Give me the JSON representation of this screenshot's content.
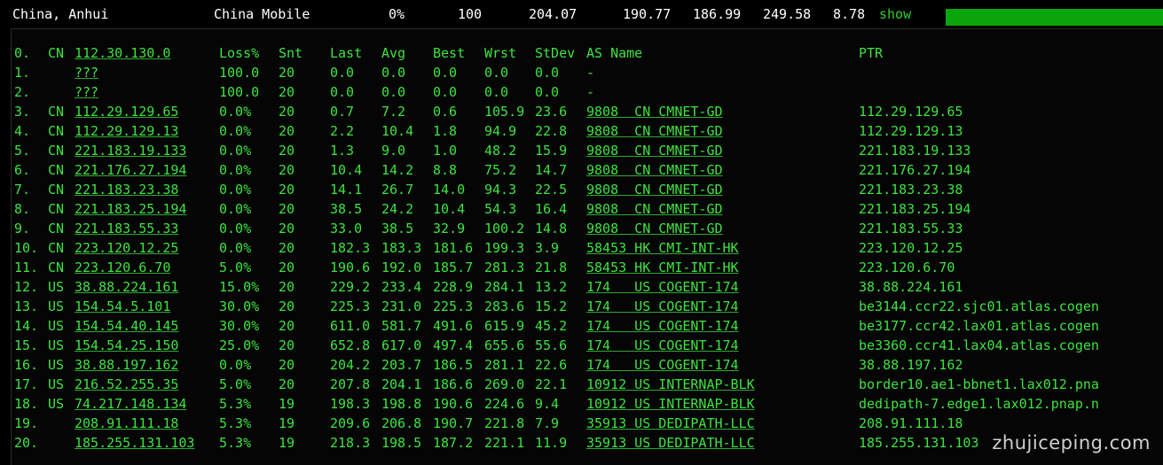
{
  "summary": {
    "location": "China, Anhui",
    "isp": "China Mobile",
    "loss": "0%",
    "sent": "100",
    "last": "204.07",
    "avg": "190.77",
    "best": "186.99",
    "worst": "249.58",
    "stdev": "8.78",
    "show_label": "show",
    "progress": 1.0
  },
  "header": {
    "hop": "0.",
    "cc": "CN",
    "host": "112.30.130.0",
    "loss": "Loss%",
    "snt": "Snt",
    "last": "Last",
    "avg": "Avg",
    "best": "Best",
    "wrst": "Wrst",
    "stdev": "StDev",
    "as": "AS Name",
    "ptr": "PTR"
  },
  "hops": [
    {
      "hop": "1.",
      "cc": "",
      "host": "???",
      "loss": "100.0",
      "snt": "20",
      "last": "0.0",
      "avg": "0.0",
      "best": "0.0",
      "wrst": "0.0",
      "stdev": "0.0",
      "as": "-",
      "ptr": ""
    },
    {
      "hop": "2.",
      "cc": "",
      "host": "???",
      "loss": "100.0",
      "snt": "20",
      "last": "0.0",
      "avg": "0.0",
      "best": "0.0",
      "wrst": "0.0",
      "stdev": "0.0",
      "as": "-",
      "ptr": ""
    },
    {
      "hop": "3.",
      "cc": "CN",
      "host": "112.29.129.65",
      "loss": "0.0%",
      "snt": "20",
      "last": "0.7",
      "avg": "7.2",
      "best": "0.6",
      "wrst": "105.9",
      "stdev": "23.6",
      "as": "9808  CN CMNET-GD",
      "ptr": "112.29.129.65"
    },
    {
      "hop": "4.",
      "cc": "CN",
      "host": "112.29.129.13",
      "loss": "0.0%",
      "snt": "20",
      "last": "2.2",
      "avg": "10.4",
      "best": "1.8",
      "wrst": "94.9",
      "stdev": "22.8",
      "as": "9808  CN CMNET-GD",
      "ptr": "112.29.129.13"
    },
    {
      "hop": "5.",
      "cc": "CN",
      "host": "221.183.19.133",
      "loss": "0.0%",
      "snt": "20",
      "last": "1.3",
      "avg": "9.0",
      "best": "1.0",
      "wrst": "48.2",
      "stdev": "15.9",
      "as": "9808  CN CMNET-GD",
      "ptr": "221.183.19.133"
    },
    {
      "hop": "6.",
      "cc": "CN",
      "host": "221.176.27.194",
      "loss": "0.0%",
      "snt": "20",
      "last": "10.4",
      "avg": "14.2",
      "best": "8.8",
      "wrst": "75.2",
      "stdev": "14.7",
      "as": "9808  CN CMNET-GD",
      "ptr": "221.176.27.194"
    },
    {
      "hop": "7.",
      "cc": "CN",
      "host": "221.183.23.38",
      "loss": "0.0%",
      "snt": "20",
      "last": "14.1",
      "avg": "26.7",
      "best": "14.0",
      "wrst": "94.3",
      "stdev": "22.5",
      "as": "9808  CN CMNET-GD",
      "ptr": "221.183.23.38"
    },
    {
      "hop": "8.",
      "cc": "CN",
      "host": "221.183.25.194",
      "loss": "0.0%",
      "snt": "20",
      "last": "38.5",
      "avg": "24.2",
      "best": "10.4",
      "wrst": "54.3",
      "stdev": "16.4",
      "as": "9808  CN CMNET-GD",
      "ptr": "221.183.25.194"
    },
    {
      "hop": "9.",
      "cc": "CN",
      "host": "221.183.55.33",
      "loss": "0.0%",
      "snt": "20",
      "last": "33.0",
      "avg": "38.5",
      "best": "32.9",
      "wrst": "100.2",
      "stdev": "14.8",
      "as": "9808  CN CMNET-GD",
      "ptr": "221.183.55.33"
    },
    {
      "hop": "10.",
      "cc": "CN",
      "host": "223.120.12.25",
      "loss": "0.0%",
      "snt": "20",
      "last": "182.3",
      "avg": "183.3",
      "best": "181.6",
      "wrst": "199.3",
      "stdev": "3.9",
      "as": "58453 HK CMI-INT-HK",
      "ptr": "223.120.12.25"
    },
    {
      "hop": "11.",
      "cc": "CN",
      "host": "223.120.6.70",
      "loss": "5.0%",
      "snt": "20",
      "last": "190.6",
      "avg": "192.0",
      "best": "185.7",
      "wrst": "281.3",
      "stdev": "21.8",
      "as": "58453 HK CMI-INT-HK",
      "ptr": "223.120.6.70"
    },
    {
      "hop": "12.",
      "cc": "US",
      "host": "38.88.224.161",
      "loss": "15.0%",
      "snt": "20",
      "last": "229.2",
      "avg": "233.4",
      "best": "228.9",
      "wrst": "284.1",
      "stdev": "13.2",
      "as": "174   US COGENT-174",
      "ptr": "38.88.224.161"
    },
    {
      "hop": "13.",
      "cc": "US",
      "host": "154.54.5.101",
      "loss": "30.0%",
      "snt": "20",
      "last": "225.3",
      "avg": "231.0",
      "best": "225.3",
      "wrst": "283.6",
      "stdev": "15.2",
      "as": "174   US COGENT-174",
      "ptr": "be3144.ccr22.sjc01.atlas.cogen"
    },
    {
      "hop": "14.",
      "cc": "US",
      "host": "154.54.40.145",
      "loss": "30.0%",
      "snt": "20",
      "last": "611.0",
      "avg": "581.7",
      "best": "491.6",
      "wrst": "615.9",
      "stdev": "45.2",
      "as": "174   US COGENT-174",
      "ptr": "be3177.ccr42.lax01.atlas.cogen"
    },
    {
      "hop": "15.",
      "cc": "US",
      "host": "154.54.25.150",
      "loss": "25.0%",
      "snt": "20",
      "last": "652.8",
      "avg": "617.0",
      "best": "497.4",
      "wrst": "655.6",
      "stdev": "55.6",
      "as": "174   US COGENT-174",
      "ptr": "be3360.ccr41.lax04.atlas.cogen"
    },
    {
      "hop": "16.",
      "cc": "US",
      "host": "38.88.197.162",
      "loss": "0.0%",
      "snt": "20",
      "last": "204.2",
      "avg": "203.7",
      "best": "186.5",
      "wrst": "281.1",
      "stdev": "22.6",
      "as": "174   US COGENT-174",
      "ptr": "38.88.197.162"
    },
    {
      "hop": "17.",
      "cc": "US",
      "host": "216.52.255.35",
      "loss": "5.0%",
      "snt": "20",
      "last": "207.8",
      "avg": "204.1",
      "best": "186.6",
      "wrst": "269.0",
      "stdev": "22.1",
      "as": "10912 US INTERNAP-BLK",
      "ptr": "border10.ae1-bbnet1.lax012.pna"
    },
    {
      "hop": "18.",
      "cc": "US",
      "host": "74.217.148.134",
      "loss": "5.3%",
      "snt": "19",
      "last": "198.3",
      "avg": "198.8",
      "best": "190.6",
      "wrst": "224.6",
      "stdev": "9.4",
      "as": "10912 US INTERNAP-BLK",
      "ptr": "dedipath-7.edge1.lax012.pnap.n"
    },
    {
      "hop": "19.",
      "cc": "",
      "host": "208.91.111.18",
      "loss": "5.3%",
      "snt": "19",
      "last": "209.6",
      "avg": "206.8",
      "best": "190.7",
      "wrst": "221.8",
      "stdev": "7.9",
      "as": "35913 US DEDIPATH-LLC",
      "ptr": "208.91.111.18"
    },
    {
      "hop": "20.",
      "cc": "",
      "host": "185.255.131.103",
      "loss": "5.3%",
      "snt": "19",
      "last": "218.3",
      "avg": "198.5",
      "best": "187.2",
      "wrst": "221.1",
      "stdev": "11.9",
      "as": "35913 US DEDIPATH-LLC",
      "ptr": "185.255.131.103"
    }
  ],
  "watermark": "zhujiceping.com"
}
